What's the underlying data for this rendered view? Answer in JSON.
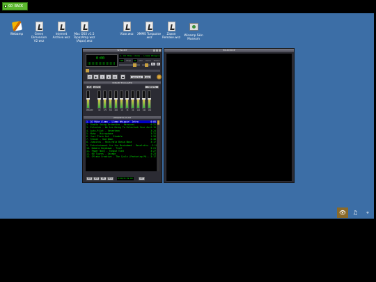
{
  "nav": {
    "go_back_label": "GO BACK"
  },
  "desktop_icons": [
    {
      "label": "Webamp",
      "icon": "webamp-pen-icon"
    },
    {
      "label": "Green Dimension V2.wsz",
      "icon": "skin-file-icon"
    },
    {
      "label": "Internet Archive.wsz",
      "icon": "skin-file-icon"
    },
    {
      "label": "Mac OSX v1.5 TopazAmp.wsz (Aqua).wsz",
      "icon": "skin-file-icon"
    },
    {
      "label": "Vizor.wsz",
      "icon": "skin-file-icon"
    },
    {
      "label": "XMMS Turquoise .wsz",
      "icon": "skin-file-icon"
    },
    {
      "label": "Zaxon Remake.wsz",
      "icon": "skin-file-icon"
    },
    {
      "label": "Winamp Skin Museum",
      "icon": "museum-icon"
    }
  ],
  "winamp": {
    "title": "WINAMP",
    "time": "0:00",
    "ticker": "1. DJ Mike Llama - Llama Whippin' Intro",
    "kbps": "128",
    "khz": "44",
    "kbps_label": "kbps",
    "khz_label": "kHz",
    "mono_label": "mono",
    "stereo_label": "stereo",
    "eq_button": "EQ",
    "pl_button": "PL",
    "shuffle_label": "SHUFFLE",
    "repeat_label": "REP",
    "equalizer_title": "WINAMP EQUALIZER",
    "eq_on_label": "ON",
    "eq_auto_label": "AUTO",
    "eq_presets_label": "PRESETS",
    "eq_bands": [
      "PREAMP",
      "60",
      "170",
      "310",
      "600",
      "1K",
      "3K",
      "6K",
      "12K",
      "14K",
      "16K"
    ],
    "eq_levels": [
      0.5,
      0.5,
      0.5,
      0.5,
      0.5,
      0.5,
      0.5,
      0.5,
      0.5,
      0.5,
      0.5
    ],
    "playlist_title": "WINAMP PLAYLIST",
    "playlist": [
      {
        "title": "1. DJ Mike Llama - Llama Whippin' Intro",
        "time": "0:05"
      },
      {
        "title": "2. Diablo Swing Orchestra - Heroines",
        "time": "6:22"
      },
      {
        "title": "3. Eclectek - We Are Going To Eclecfunk Your Ass",
        "time": "2:15"
      },
      {
        "title": "4. Auto-Pilot - Seventeen",
        "time": "3:24"
      },
      {
        "title": "5. Muha - Microphone",
        "time": "3:31"
      },
      {
        "title": "6. Just Plain Ant - Stumble",
        "time": "1:28"
      },
      {
        "title": "7. Sleaze - God Damn",
        "time": "2:48"
      },
      {
        "title": "8. Juanitos - Hola Hola Bossa Nova",
        "time": "3:17"
      },
      {
        "title": "9. Entertainment for the Braindead - Resolutio...",
        "time": "3:14"
      },
      {
        "title": "10. Nobara Hayakawa - Trail",
        "time": "3:21"
      },
      {
        "title": "11. Paper Navy - Tongue Tied",
        "time": "3:27"
      },
      {
        "title": "12. 60 Tigres - Garage",
        "time": "4:23"
      },
      {
        "title": "13. CM aka Creative - The Cycle (Featuring Mi...",
        "time": "3:17"
      }
    ],
    "pl_buttons": [
      "ADD",
      "REM",
      "SEL",
      "MISC",
      "LIST"
    ],
    "pl_time": "0:00/0:59:00"
  },
  "milkdrop": {
    "title": "MILKDROP"
  },
  "tray": [
    {
      "icon": "eye-icon",
      "glyph": "👁"
    },
    {
      "icon": "music-note-icon",
      "glyph": "♫"
    },
    {
      "icon": "github-icon",
      "glyph": "⚬"
    }
  ],
  "colors": {
    "desktop": "#3c6ea6",
    "go_back": "#5cb82f",
    "lcd_green": "#00e000",
    "selection": "#0000c6"
  }
}
